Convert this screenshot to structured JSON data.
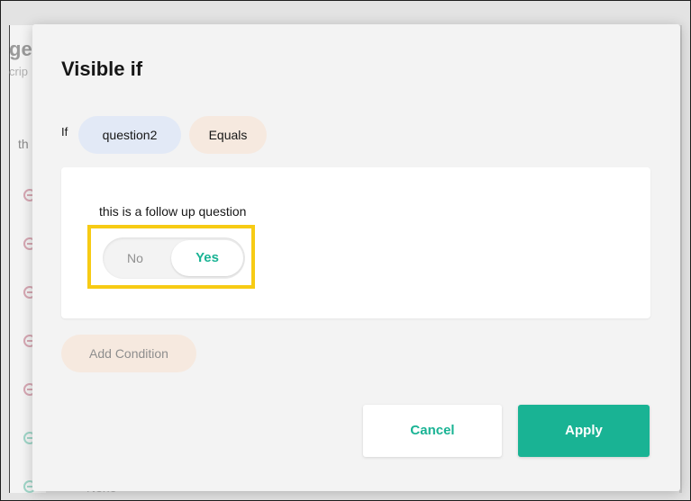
{
  "background": {
    "title_fragment": "ge",
    "subtitle_fragment": "crip",
    "row_label_fragment": "th",
    "bottom_text_fragment": "None"
  },
  "dialog": {
    "title": "Visible if",
    "if_label": "If",
    "question_chip": "question2",
    "operator_chip": "Equals",
    "condition": {
      "question_text": "this is a follow up question",
      "toggle": {
        "off_label": "No",
        "on_label": "Yes",
        "selected": "Yes"
      }
    },
    "add_condition_label": "Add Condition",
    "cancel_label": "Cancel",
    "apply_label": "Apply"
  },
  "colors": {
    "accent": "#19b394",
    "highlight": "#f7cb14",
    "question_chip_bg": "#e2e9f6",
    "operator_chip_bg": "#f6e9df"
  }
}
